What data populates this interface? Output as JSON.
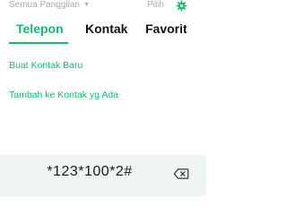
{
  "header": {
    "filter_label": "Semua Panggilan",
    "select_label": "Pilih"
  },
  "tabs": [
    {
      "label": "Telepon",
      "active": true
    },
    {
      "label": "Kontak",
      "active": false
    },
    {
      "label": "Favorit",
      "active": false
    }
  ],
  "actions": {
    "create_contact": "Buat Kontak Baru",
    "add_to_existing": "Tambah ke Kontak yg Ada"
  },
  "dialer": {
    "number": "*123*100*2#"
  },
  "colors": {
    "accent": "#17b86a",
    "muted": "#a9a9a9",
    "dialer_bg": "#eef4f1"
  },
  "icons": {
    "filter": "chevron-down-icon",
    "settings": "gear-icon",
    "delete": "backspace-icon"
  }
}
